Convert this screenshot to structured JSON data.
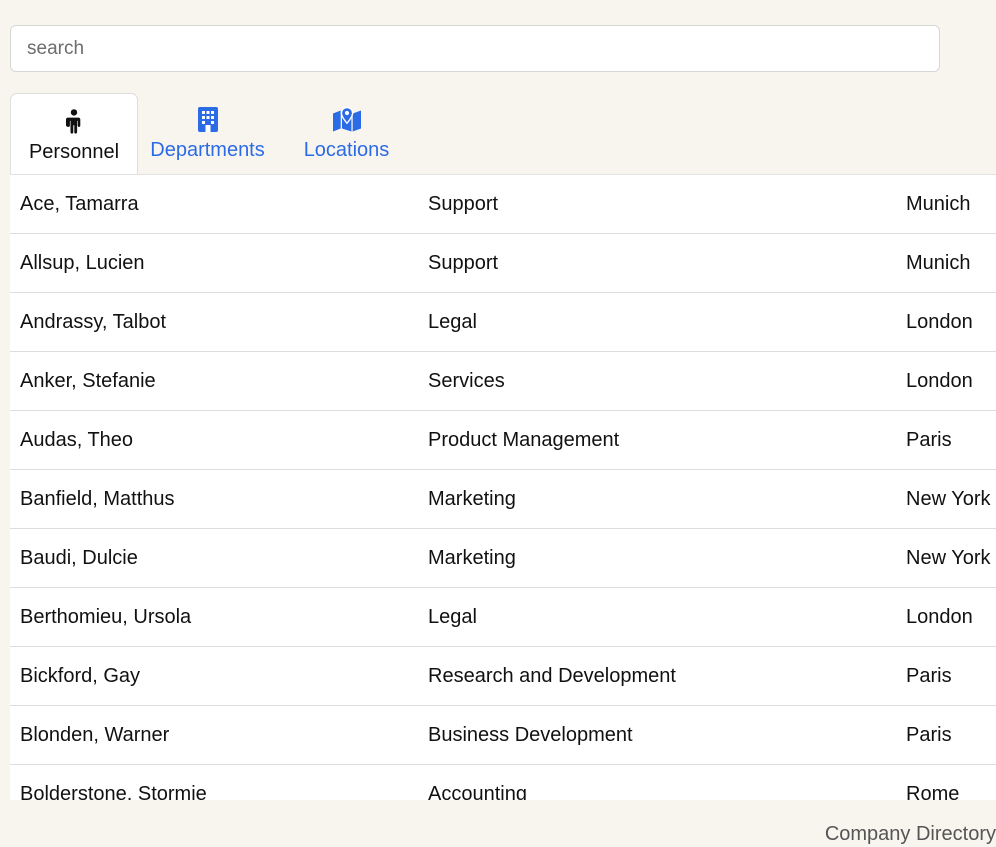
{
  "search": {
    "placeholder": "search",
    "value": ""
  },
  "tabs": [
    {
      "label": "Personnel",
      "icon": "person-icon",
      "active": true
    },
    {
      "label": "Departments",
      "icon": "building-icon",
      "active": false
    },
    {
      "label": "Locations",
      "icon": "map-location-icon",
      "active": false
    }
  ],
  "rows": [
    {
      "name": "Ace, Tamarra",
      "department": "Support",
      "location": "Munich"
    },
    {
      "name": "Allsup, Lucien",
      "department": "Support",
      "location": "Munich"
    },
    {
      "name": "Andrassy, Talbot",
      "department": "Legal",
      "location": "London"
    },
    {
      "name": "Anker, Stefanie",
      "department": "Services",
      "location": "London"
    },
    {
      "name": "Audas, Theo",
      "department": "Product Management",
      "location": "Paris"
    },
    {
      "name": "Banfield, Matthus",
      "department": "Marketing",
      "location": "New York"
    },
    {
      "name": "Baudi, Dulcie",
      "department": "Marketing",
      "location": "New York"
    },
    {
      "name": "Berthomieu, Ursola",
      "department": "Legal",
      "location": "London"
    },
    {
      "name": "Bickford, Gay",
      "department": "Research and Development",
      "location": "Paris"
    },
    {
      "name": "Blonden, Warner",
      "department": "Business Development",
      "location": "Paris"
    },
    {
      "name": "Bolderstone, Stormie",
      "department": "Accounting",
      "location": "Rome"
    }
  ],
  "footer": {
    "text": "Company Directory"
  },
  "colors": {
    "page_background": "#f8f5ef",
    "active_tab_text": "#111111",
    "inactive_tab_text": "#2c6be6",
    "row_border": "#dddddd",
    "footer_text": "#555555"
  }
}
